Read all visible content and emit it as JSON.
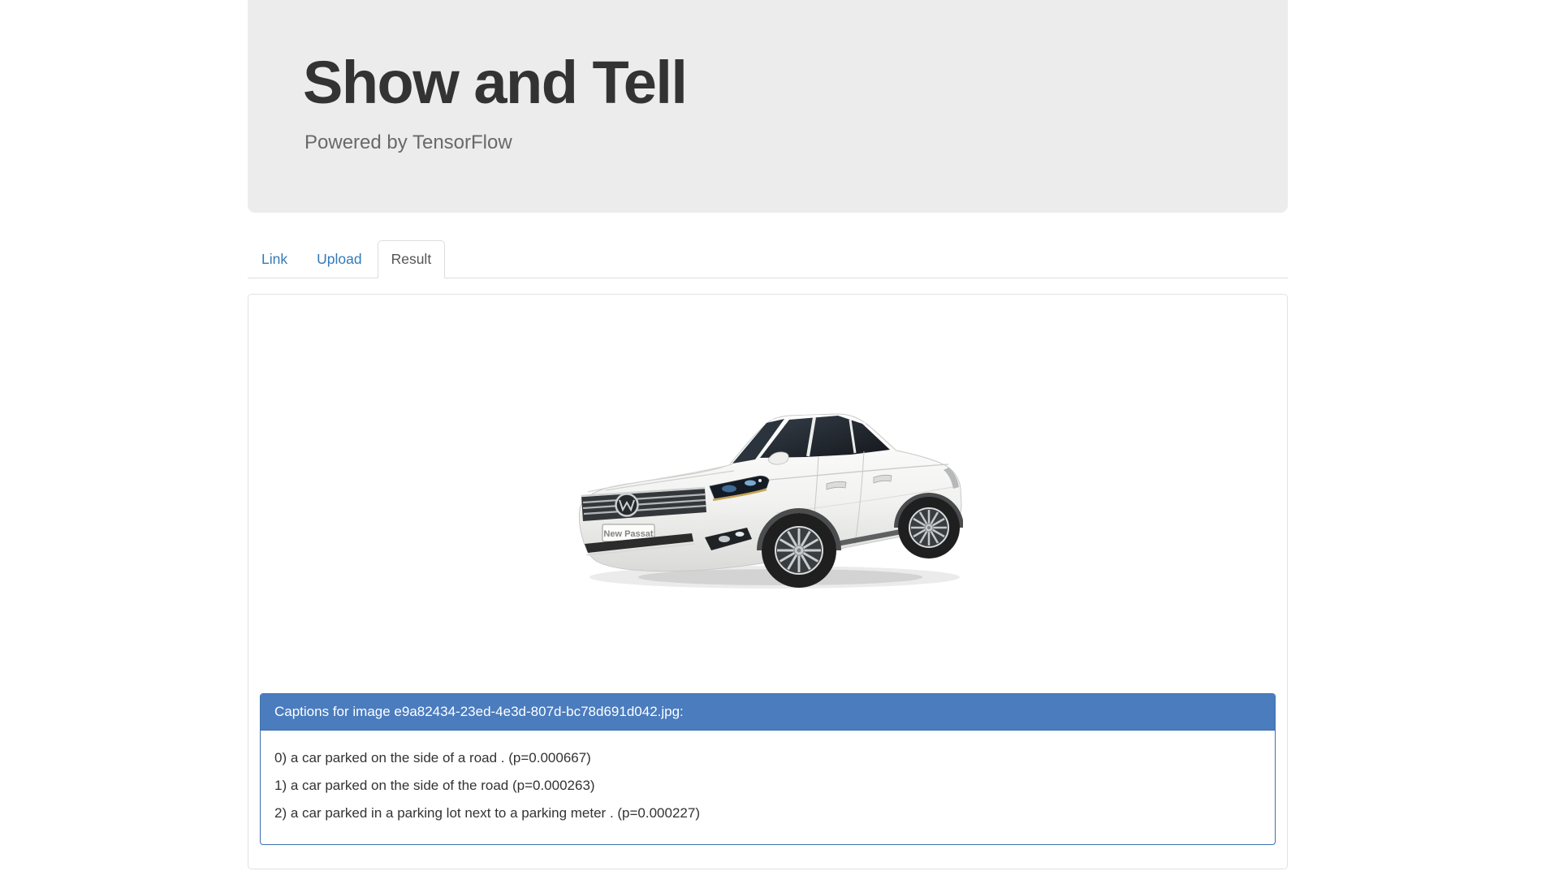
{
  "page": {
    "title": "Show and Tell",
    "subtitle": "Powered by TensorFlow"
  },
  "tabs": [
    {
      "label": "Link",
      "active": false
    },
    {
      "label": "Upload",
      "active": false
    },
    {
      "label": "Result",
      "active": true
    }
  ],
  "result": {
    "image": {
      "plate_text": "New Passat"
    },
    "captions_panel": {
      "heading": "Captions for image e9a82434-23ed-4e3d-807d-bc78d691d042.jpg:",
      "captions": [
        "0) a car parked on the side of a road . (p=0.000667)",
        "1) a car parked on the side of the road (p=0.000263)",
        "2) a car parked in a parking lot next to a parking meter . (p=0.000227)"
      ]
    }
  },
  "colors": {
    "jumbotron_bg": "#ececec",
    "link_blue": "#337ab7",
    "caption_header_bg": "#4a7cbe",
    "caption_border": "#3e70ae",
    "tab_border": "#dddddd"
  }
}
